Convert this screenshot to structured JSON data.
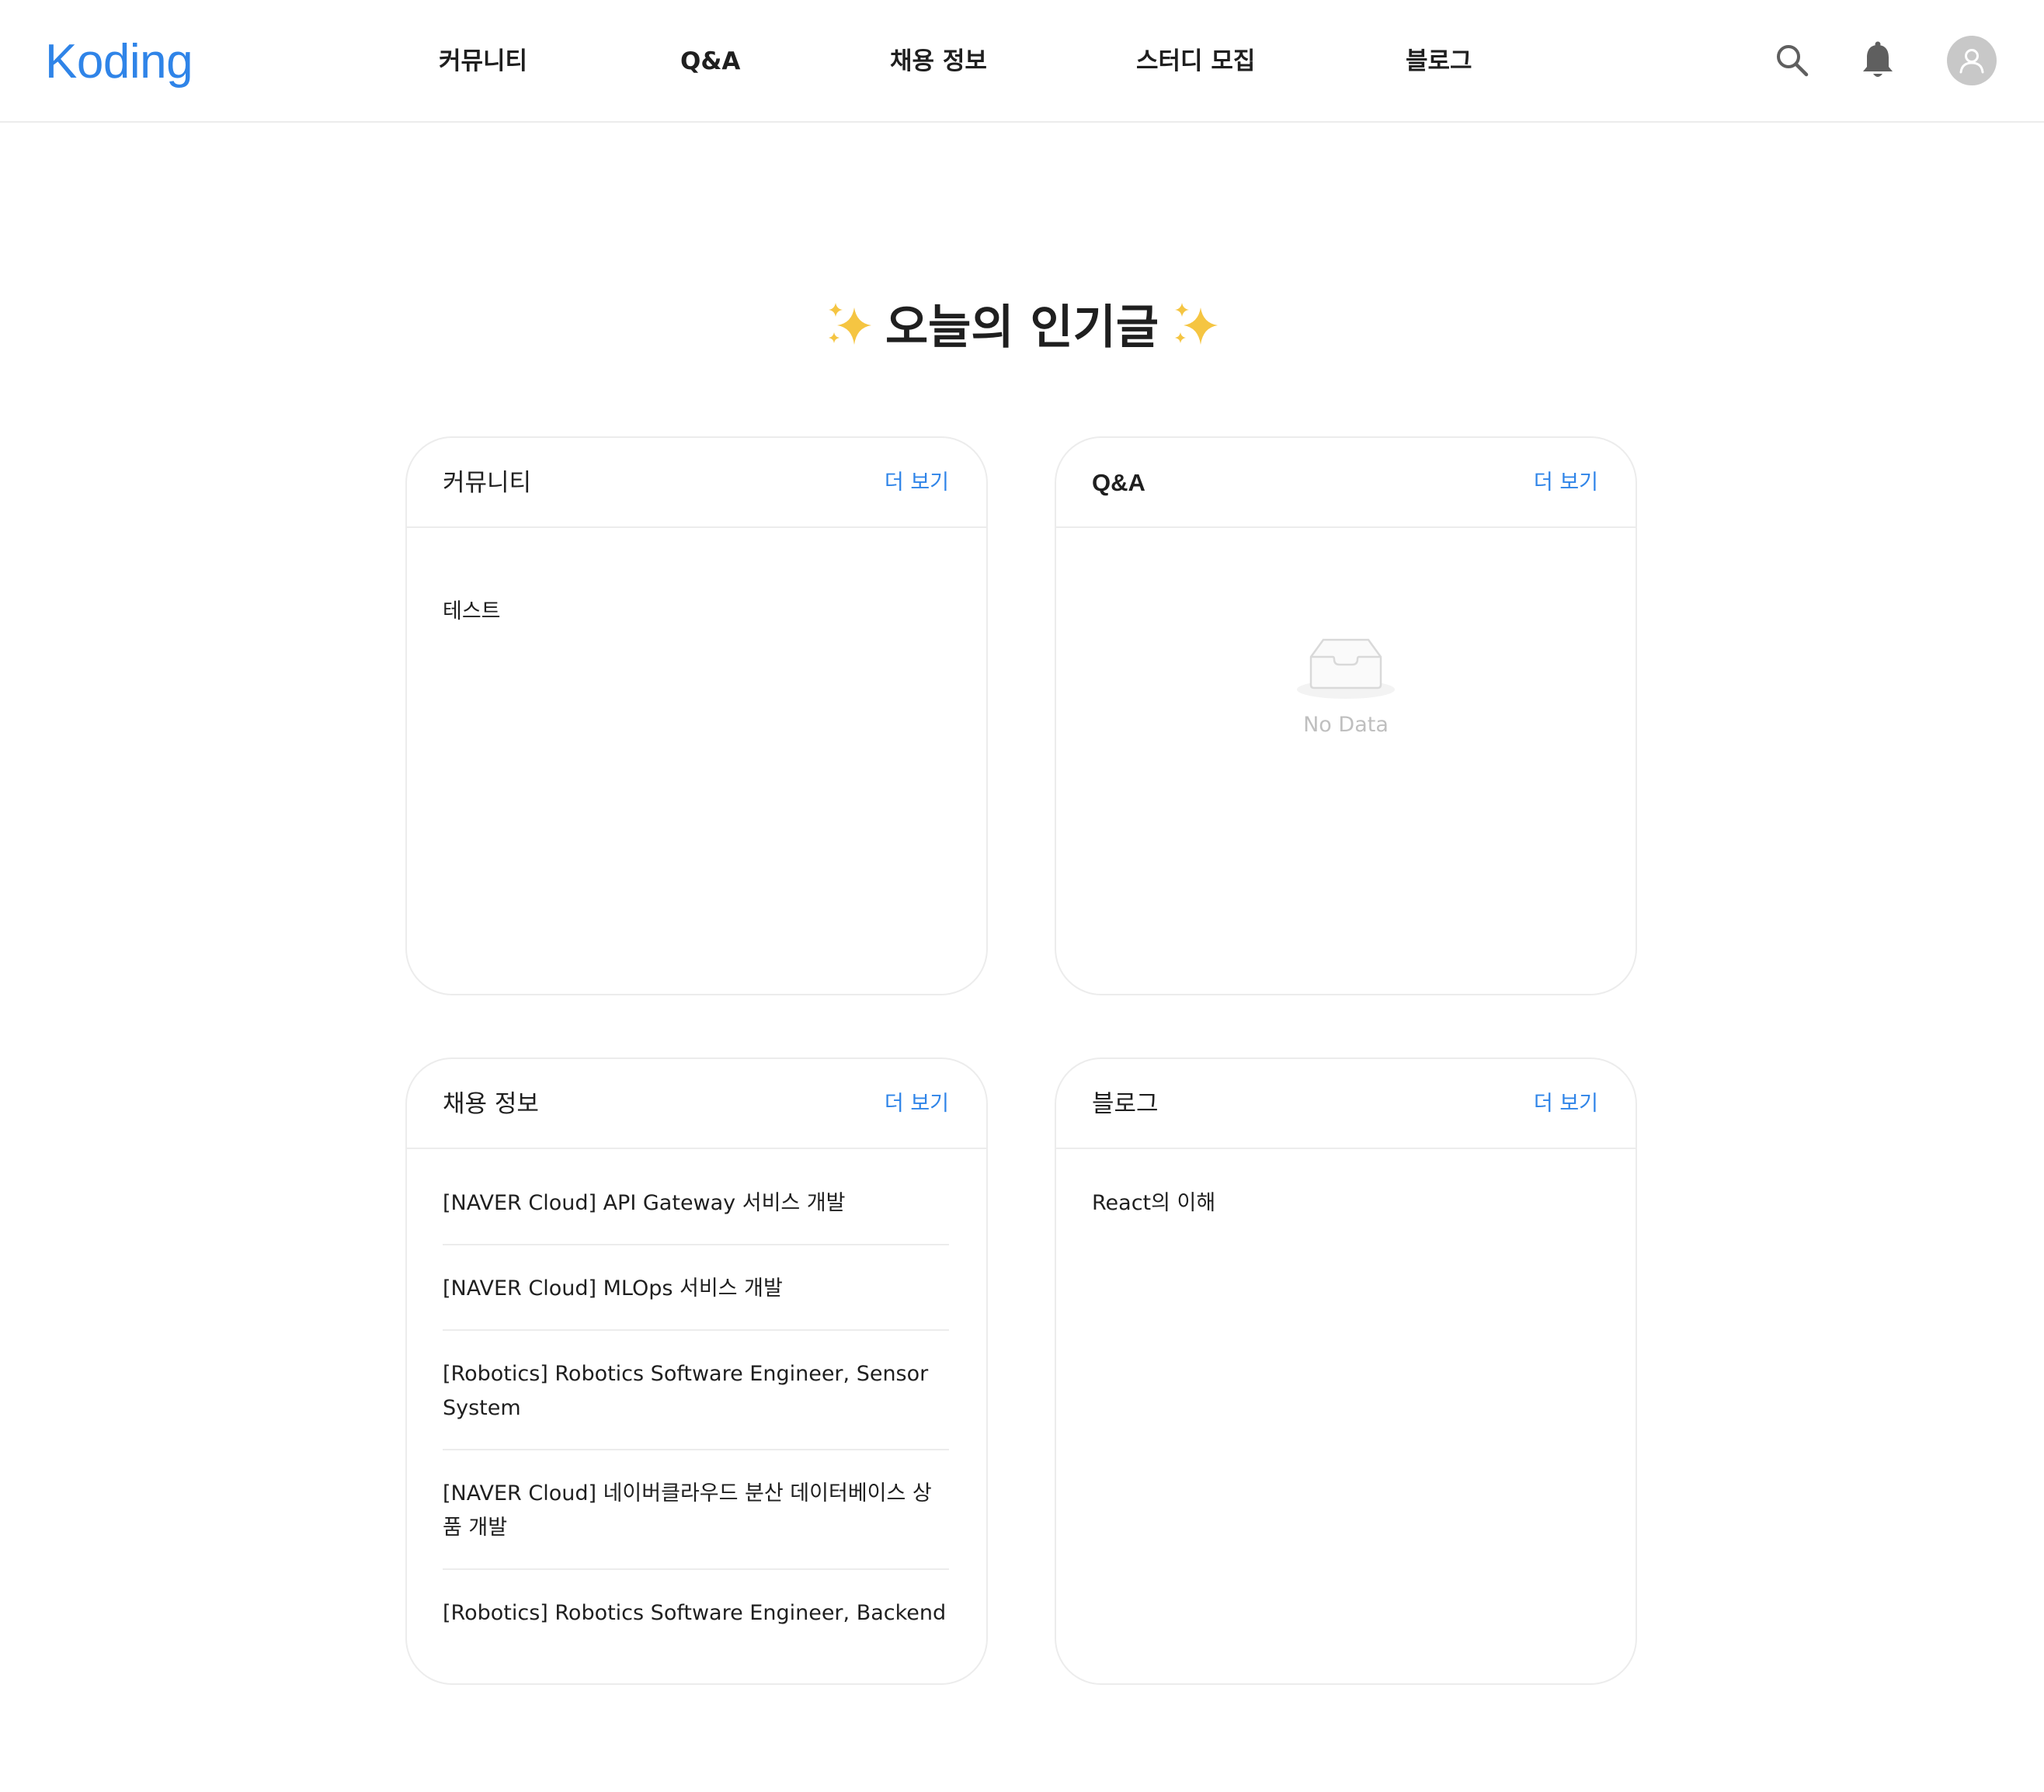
{
  "header": {
    "logo": "Koding",
    "nav": [
      "커뮤니티",
      "Q&A",
      "채용 정보",
      "스터디 모집",
      "블로그"
    ],
    "icons": [
      "search-icon",
      "bell-icon",
      "user-icon"
    ]
  },
  "title": "오늘의 인기글",
  "title_decoration": "sparkles-icon",
  "colors": {
    "accent": "#2f84e8",
    "text": "#1f1f1f",
    "border": "#ececec",
    "muted": "#bfbfbf"
  },
  "cards": {
    "community": {
      "title": "커뮤니티",
      "more": "더 보기",
      "posts": [
        "테스트"
      ]
    },
    "qna": {
      "title": "Q&A",
      "more": "더 보기",
      "empty_text": "No Data",
      "empty_icon": "inbox-icon"
    },
    "jobs": {
      "title": "채용 정보",
      "more": "더 보기",
      "posts": [
        "[NAVER Cloud] API Gateway 서비스 개발",
        "[NAVER Cloud] MLOps 서비스 개발",
        "[Robotics] Robotics Software Engineer, Sensor System",
        "[NAVER Cloud] 네이버클라우드 분산 데이터베이스 상품 개발",
        "[Robotics] Robotics Software Engineer, Backend"
      ]
    },
    "blog": {
      "title": "블로그",
      "more": "더 보기",
      "posts": [
        "React의 이해"
      ]
    }
  }
}
